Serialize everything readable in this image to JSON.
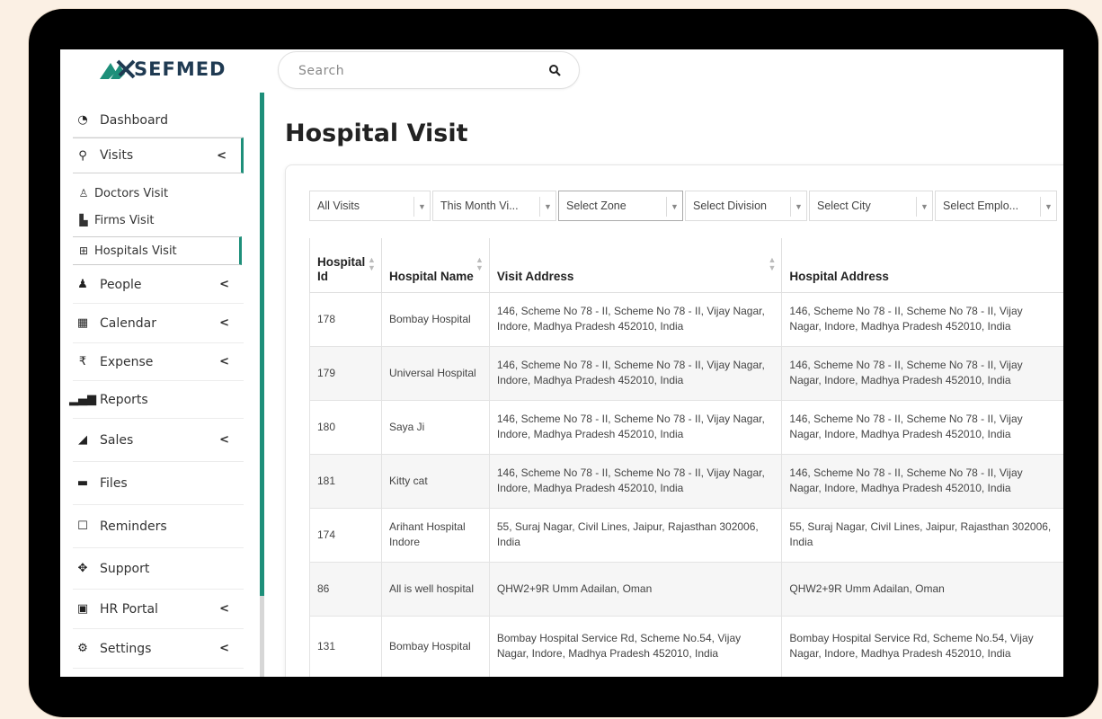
{
  "app": {
    "logo_text": "SEFMED",
    "brand_color": "#1e8f7a",
    "logo_color": "#1f3a52"
  },
  "search": {
    "placeholder": "Search",
    "icon": "search-icon"
  },
  "sidebar": {
    "items": [
      {
        "label": "Dashboard",
        "icon": "dashboard-icon",
        "has_chevron": false
      },
      {
        "label": "Visits",
        "icon": "map-pin-icon",
        "has_chevron": true,
        "active": true
      },
      {
        "label": "People",
        "icon": "user-icon",
        "has_chevron": true
      },
      {
        "label": "Calendar",
        "icon": "calendar-icon",
        "has_chevron": true
      },
      {
        "label": "Expense",
        "icon": "rupee-icon",
        "has_chevron": true
      },
      {
        "label": "Reports",
        "icon": "bar-chart-icon",
        "has_chevron": false
      },
      {
        "label": "Sales",
        "icon": "sales-chart-icon",
        "has_chevron": true
      },
      {
        "label": "Files",
        "icon": "folder-icon",
        "has_chevron": false
      },
      {
        "label": "Reminders",
        "icon": "reminder-icon",
        "has_chevron": false
      },
      {
        "label": "Support",
        "icon": "support-icon",
        "has_chevron": false
      },
      {
        "label": "HR Portal",
        "icon": "hr-portal-icon",
        "has_chevron": true
      },
      {
        "label": "Settings",
        "icon": "cogs-icon",
        "has_chevron": true
      }
    ],
    "sub_items": [
      {
        "label": "Doctors Visit",
        "icon": "doctor-icon"
      },
      {
        "label": "Firms Visit",
        "icon": "factory-icon"
      },
      {
        "label": "Hospitals Visit",
        "icon": "hospital-icon",
        "active": true
      }
    ],
    "chevron": "<"
  },
  "main": {
    "title": "Hospital Visit",
    "filters": [
      {
        "label": "All Visits"
      },
      {
        "label": "This Month Vi..."
      },
      {
        "label": "Select Zone"
      },
      {
        "label": "Select Division"
      },
      {
        "label": "Select City"
      },
      {
        "label": "Select Emplo..."
      }
    ],
    "table": {
      "columns": [
        "Hospital Id",
        "Hospital Name",
        "Visit Address",
        "Hospital Address"
      ],
      "rows": [
        {
          "id": "178",
          "name": "Bombay Hospital",
          "visit": "146, Scheme No 78 - II, Scheme No 78 - II, Vijay Nagar, Indore, Madhya Pradesh 452010, India",
          "hospital": "146, Scheme No 78 - II, Scheme No 78 - II, Vijay Nagar, Indore, Madhya Pradesh 452010, India"
        },
        {
          "id": "179",
          "name": "Universal Hospital",
          "visit": "146, Scheme No 78 - II, Scheme No 78 - II, Vijay Nagar, Indore, Madhya Pradesh 452010, India",
          "hospital": "146, Scheme No 78 - II, Scheme No 78 - II, Vijay Nagar, Indore, Madhya Pradesh 452010, India"
        },
        {
          "id": "180",
          "name": "Saya Ji",
          "visit": "146, Scheme No 78 - II, Scheme No 78 - II, Vijay Nagar, Indore, Madhya Pradesh 452010, India",
          "hospital": "146, Scheme No 78 - II, Scheme No 78 - II, Vijay Nagar, Indore, Madhya Pradesh 452010, India"
        },
        {
          "id": "181",
          "name": "Kitty cat",
          "visit": "146, Scheme No 78 - II, Scheme No 78 - II, Vijay Nagar, Indore, Madhya Pradesh 452010, India",
          "hospital": "146, Scheme No 78 - II, Scheme No 78 - II, Vijay Nagar, Indore, Madhya Pradesh 452010, India"
        },
        {
          "id": "174",
          "name": "Arihant Hospital Indore",
          "visit": "55, Suraj Nagar, Civil Lines, Jaipur, Rajasthan 302006, India",
          "hospital": "55, Suraj Nagar, Civil Lines, Jaipur, Rajasthan 302006, India"
        },
        {
          "id": "86",
          "name": "All is well hospital",
          "visit": "QHW2+9R Umm Adailan, Oman",
          "hospital": "QHW2+9R Umm Adailan, Oman"
        },
        {
          "id": "131",
          "name": "Bombay Hospital",
          "visit": "Bombay Hospital Service Rd, Scheme No.54, Vijay Nagar, Indore, Madhya Pradesh 452010, India",
          "hospital": "Bombay Hospital Service Rd, Scheme No.54, Vijay Nagar, Indore, Madhya Pradesh 452010, India"
        }
      ]
    }
  }
}
